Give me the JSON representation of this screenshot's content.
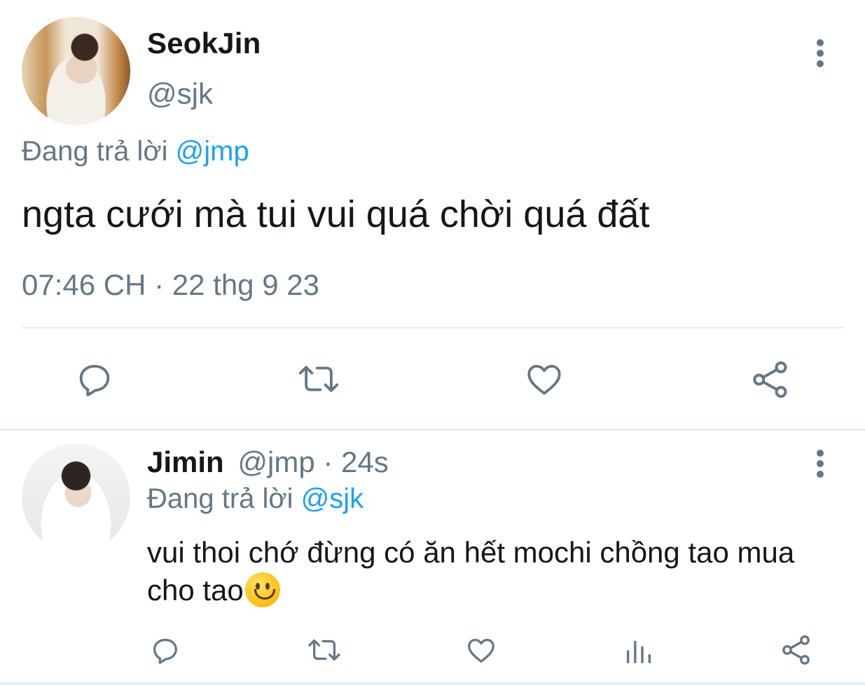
{
  "colors": {
    "text_primary": "#14171a",
    "text_secondary": "#657786",
    "mention": "#1da1f2",
    "icon": "#657786",
    "divider": "#e6ecf0"
  },
  "main_tweet": {
    "display_name": "SeokJin",
    "handle": "@sjk",
    "replying_prefix": "Đang trả lời ",
    "replying_to": "@jmp",
    "text": "ngta cưới mà tui vui quá chời quá đất",
    "timestamp": "07:46 CH · 22 thg 9 23",
    "actions": [
      {
        "name": "reply",
        "icon": "comment-icon"
      },
      {
        "name": "retweet",
        "icon": "retweet-icon"
      },
      {
        "name": "like",
        "icon": "heart-icon"
      },
      {
        "name": "share",
        "icon": "share-icon"
      }
    ]
  },
  "reply_tweet": {
    "display_name": "Jimin",
    "handle_time": "@jmp · 24s",
    "replying_prefix": "Đang trả lời ",
    "replying_to": "@sjk",
    "text": "vui thoi chớ đừng có ăn hết mochi chồng tao mua cho tao",
    "emoji": "slightly-smiling-face-emoji",
    "actions": [
      {
        "name": "reply",
        "icon": "comment-icon"
      },
      {
        "name": "retweet",
        "icon": "retweet-icon"
      },
      {
        "name": "like",
        "icon": "heart-icon"
      },
      {
        "name": "analytics",
        "icon": "bar-chart-icon"
      },
      {
        "name": "share",
        "icon": "share-icon"
      }
    ]
  }
}
